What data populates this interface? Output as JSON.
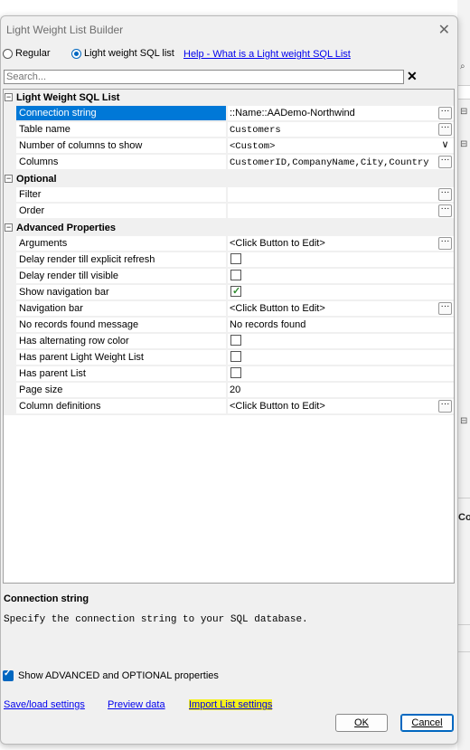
{
  "dialog": {
    "title": "Light Weight List Builder",
    "close_glyph": "✕"
  },
  "modes": {
    "regular_label": "Regular",
    "lightweight_label": "Light weight SQL list",
    "selected": "lightweight",
    "help_link": "Help - What is a Light weight SQL List"
  },
  "search": {
    "placeholder": "Search...",
    "clear_glyph": "✕"
  },
  "grid": {
    "categories": {
      "light": "Light Weight SQL List",
      "optional": "Optional",
      "advanced": "Advanced Properties"
    },
    "toggle_glyph": "−",
    "rows": {
      "connection_string": {
        "name": "Connection string",
        "value": "::Name::AADemo-Northwind"
      },
      "table_name": {
        "name": "Table name",
        "value": "Customers"
      },
      "num_columns": {
        "name": "Number of columns to show",
        "value": "<Custom>"
      },
      "columns": {
        "name": "Columns",
        "value": "CustomerID,CompanyName,City,Country"
      },
      "filter": {
        "name": "Filter",
        "value": ""
      },
      "order": {
        "name": "Order",
        "value": ""
      },
      "arguments": {
        "name": "Arguments",
        "value": "<Click Button to Edit>"
      },
      "delay_refresh": {
        "name": "Delay render till explicit refresh",
        "checked": false
      },
      "delay_visible": {
        "name": "Delay render till visible",
        "checked": false
      },
      "show_nav_bar": {
        "name": "Show navigation bar",
        "checked": true
      },
      "nav_bar": {
        "name": "Navigation bar",
        "value": "<Click Button to Edit>"
      },
      "no_records_msg": {
        "name": "No records found message",
        "value": "No records found"
      },
      "alt_row_color": {
        "name": "Has alternating row color",
        "checked": false
      },
      "parent_lw_list": {
        "name": "Has parent Light Weight List",
        "checked": false
      },
      "parent_list": {
        "name": "Has parent List",
        "checked": false
      },
      "page_size": {
        "name": "Page size",
        "value": "20"
      },
      "column_defs": {
        "name": "Column definitions",
        "value": "<Click Button to Edit>"
      }
    },
    "ellipsis_glyph": "···",
    "dropdown_glyph": "∨"
  },
  "description": {
    "title": "Connection string",
    "text": "Specify the connection string to your SQL database."
  },
  "show_advanced": {
    "label": "Show ADVANCED and OPTIONAL properties",
    "checked": true
  },
  "links": {
    "save_load": "Save/load settings",
    "preview": "Preview data",
    "import": "Import List settings"
  },
  "buttons": {
    "ok": "OK",
    "cancel": "Cancel"
  },
  "background": {
    "co_text": "Co"
  },
  "colors": {
    "selection": "#0078d7",
    "link": "#0000ee",
    "highlight": "#f5f01e",
    "accent": "#0067c0"
  }
}
